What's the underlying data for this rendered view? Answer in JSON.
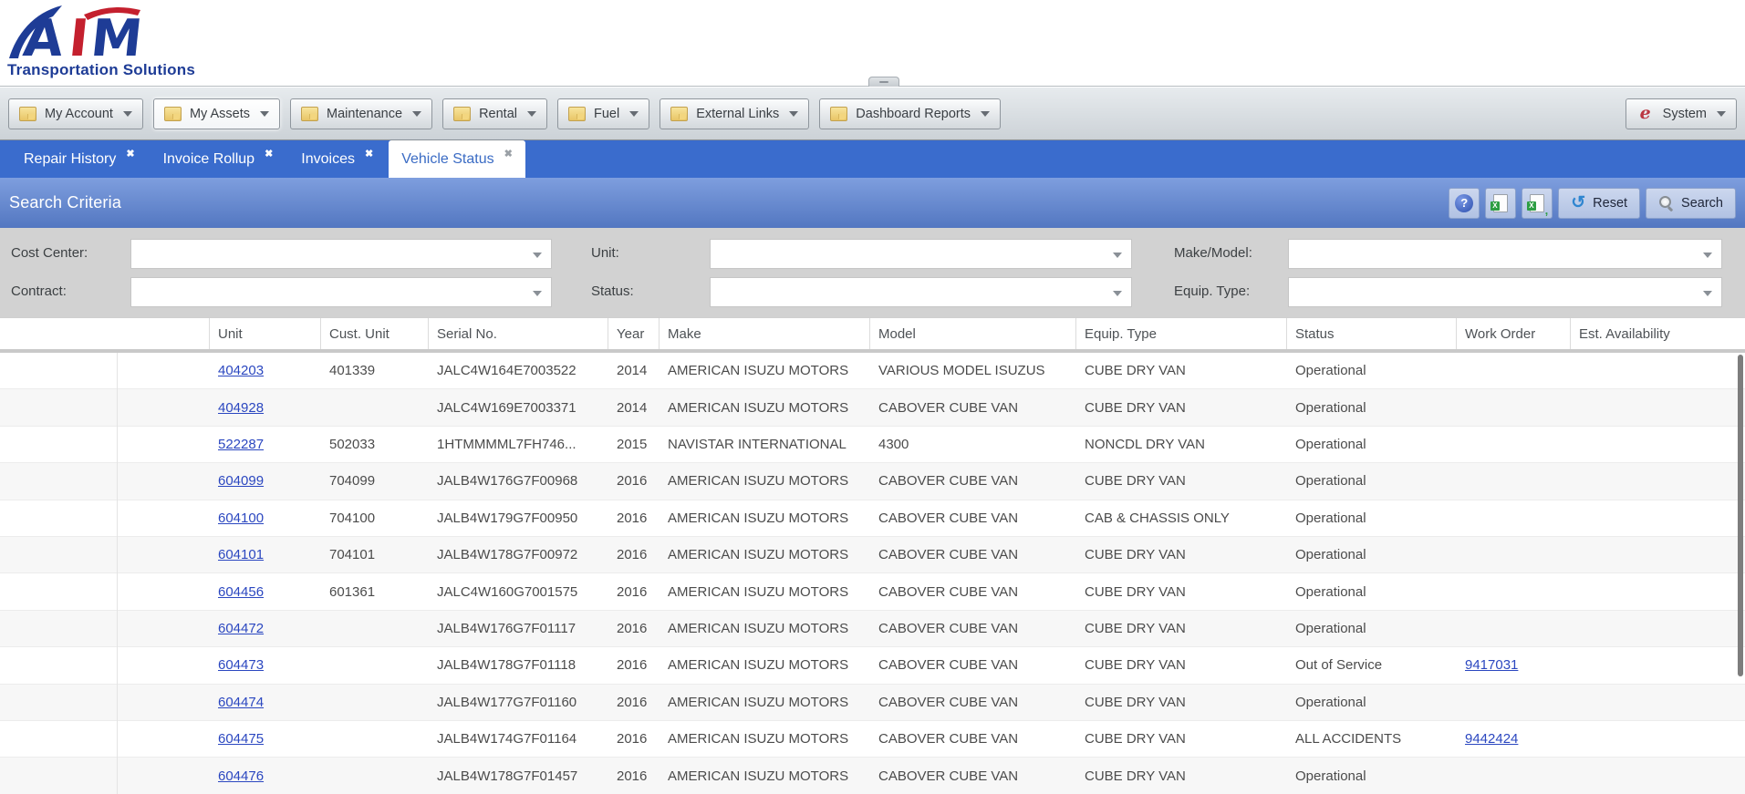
{
  "brand": {
    "letters": [
      {
        "char": "A",
        "color": "#1e3c96"
      },
      {
        "char": "I",
        "color": "#c4202e"
      },
      {
        "char": "M",
        "color": "#1e3c96"
      }
    ],
    "tagline": "Transportation Solutions"
  },
  "menubar": {
    "items": [
      "My Account",
      "My Assets",
      "Maintenance",
      "Rental",
      "Fuel",
      "External Links",
      "Dashboard Reports"
    ],
    "active_item": "My Assets",
    "system": {
      "label": "System"
    }
  },
  "tabs": {
    "items": [
      {
        "label": "Repair History",
        "active": false
      },
      {
        "label": "Invoice Rollup",
        "active": false
      },
      {
        "label": "Invoices",
        "active": false
      },
      {
        "label": "Vehicle Status",
        "active": true
      }
    ]
  },
  "search_panel": {
    "title": "Search Criteria",
    "reset_label": "Reset",
    "search_label": "Search"
  },
  "filters": {
    "fields": [
      {
        "label": "Cost Center:",
        "value": ""
      },
      {
        "label": "Contract:",
        "value": ""
      },
      {
        "label": "Unit:",
        "value": ""
      },
      {
        "label": "Status:",
        "value": ""
      },
      {
        "label": "Make/Model:",
        "value": ""
      },
      {
        "label": "Equip. Type:",
        "value": ""
      }
    ]
  },
  "grid": {
    "columns": [
      "",
      "Unit",
      "Cust. Unit",
      "Serial No.",
      "Year",
      "Make",
      "Model",
      "Equip. Type",
      "Status",
      "Work Order",
      "Est. Availability"
    ],
    "rows": [
      {
        "unit": "404203",
        "cust_unit": "401339",
        "serial_no": "JALC4W164E7003522",
        "year": "2014",
        "make": "AMERICAN ISUZU MOTORS",
        "model": "VARIOUS MODEL ISUZUS",
        "equip_type": "CUBE DRY VAN",
        "status": "Operational",
        "work_order": "",
        "est_availability": ""
      },
      {
        "unit": "404928",
        "cust_unit": "",
        "serial_no": "JALC4W169E7003371",
        "year": "2014",
        "make": "AMERICAN ISUZU MOTORS",
        "model": "CABOVER CUBE VAN",
        "equip_type": "CUBE DRY VAN",
        "status": "Operational",
        "work_order": "",
        "est_availability": ""
      },
      {
        "unit": "522287",
        "cust_unit": "502033",
        "serial_no": "1HTMMMML7FH746...",
        "year": "2015",
        "make": "NAVISTAR INTERNATIONAL",
        "model": "4300",
        "equip_type": "NONCDL DRY VAN",
        "status": "Operational",
        "work_order": "",
        "est_availability": ""
      },
      {
        "unit": "604099",
        "cust_unit": "704099",
        "serial_no": "JALB4W176G7F00968",
        "year": "2016",
        "make": "AMERICAN ISUZU MOTORS",
        "model": "CABOVER CUBE VAN",
        "equip_type": "CUBE DRY VAN",
        "status": "Operational",
        "work_order": "",
        "est_availability": ""
      },
      {
        "unit": "604100",
        "cust_unit": "704100",
        "serial_no": "JALB4W179G7F00950",
        "year": "2016",
        "make": "AMERICAN ISUZU MOTORS",
        "model": "CABOVER CUBE VAN",
        "equip_type": "CAB & CHASSIS ONLY",
        "status": "Operational",
        "work_order": "",
        "est_availability": ""
      },
      {
        "unit": "604101",
        "cust_unit": "704101",
        "serial_no": "JALB4W178G7F00972",
        "year": "2016",
        "make": "AMERICAN ISUZU MOTORS",
        "model": "CABOVER CUBE VAN",
        "equip_type": "CUBE DRY VAN",
        "status": "Operational",
        "work_order": "",
        "est_availability": ""
      },
      {
        "unit": "604456",
        "cust_unit": "601361",
        "serial_no": "JALC4W160G7001575",
        "year": "2016",
        "make": "AMERICAN ISUZU MOTORS",
        "model": "CABOVER CUBE VAN",
        "equip_type": "CUBE DRY VAN",
        "status": "Operational",
        "work_order": "",
        "est_availability": ""
      },
      {
        "unit": "604472",
        "cust_unit": "",
        "serial_no": "JALB4W176G7F01117",
        "year": "2016",
        "make": "AMERICAN ISUZU MOTORS",
        "model": "CABOVER CUBE VAN",
        "equip_type": "CUBE DRY VAN",
        "status": "Operational",
        "work_order": "",
        "est_availability": ""
      },
      {
        "unit": "604473",
        "cust_unit": "",
        "serial_no": "JALB4W178G7F01118",
        "year": "2016",
        "make": "AMERICAN ISUZU MOTORS",
        "model": "CABOVER CUBE VAN",
        "equip_type": "CUBE DRY VAN",
        "status": "Out of Service",
        "work_order": "9417031",
        "est_availability": ""
      },
      {
        "unit": "604474",
        "cust_unit": "",
        "serial_no": "JALB4W177G7F01160",
        "year": "2016",
        "make": "AMERICAN ISUZU MOTORS",
        "model": "CABOVER CUBE VAN",
        "equip_type": "CUBE DRY VAN",
        "status": "Operational",
        "work_order": "",
        "est_availability": ""
      },
      {
        "unit": "604475",
        "cust_unit": "",
        "serial_no": "JALB4W174G7F01164",
        "year": "2016",
        "make": "AMERICAN ISUZU MOTORS",
        "model": "CABOVER CUBE VAN",
        "equip_type": "CUBE DRY VAN",
        "status": "ALL ACCIDENTS",
        "work_order": "9442424",
        "est_availability": ""
      },
      {
        "unit": "604476",
        "cust_unit": "",
        "serial_no": "JALB4W178G7F01457",
        "year": "2016",
        "make": "AMERICAN ISUZU MOTORS",
        "model": "CABOVER CUBE VAN",
        "equip_type": "CUBE DRY VAN",
        "status": "Operational",
        "work_order": "",
        "est_availability": ""
      }
    ]
  },
  "colors": {
    "tab_blue": "#3a6ccd",
    "searchbar_blue_top": "#7e9ede",
    "searchbar_blue_bottom": "#5377c1",
    "link_blue": "#2b47c0",
    "filter_panel_gray": "#d2d2d2",
    "logo_blue": "#1e3c96",
    "logo_red": "#c4202e"
  }
}
